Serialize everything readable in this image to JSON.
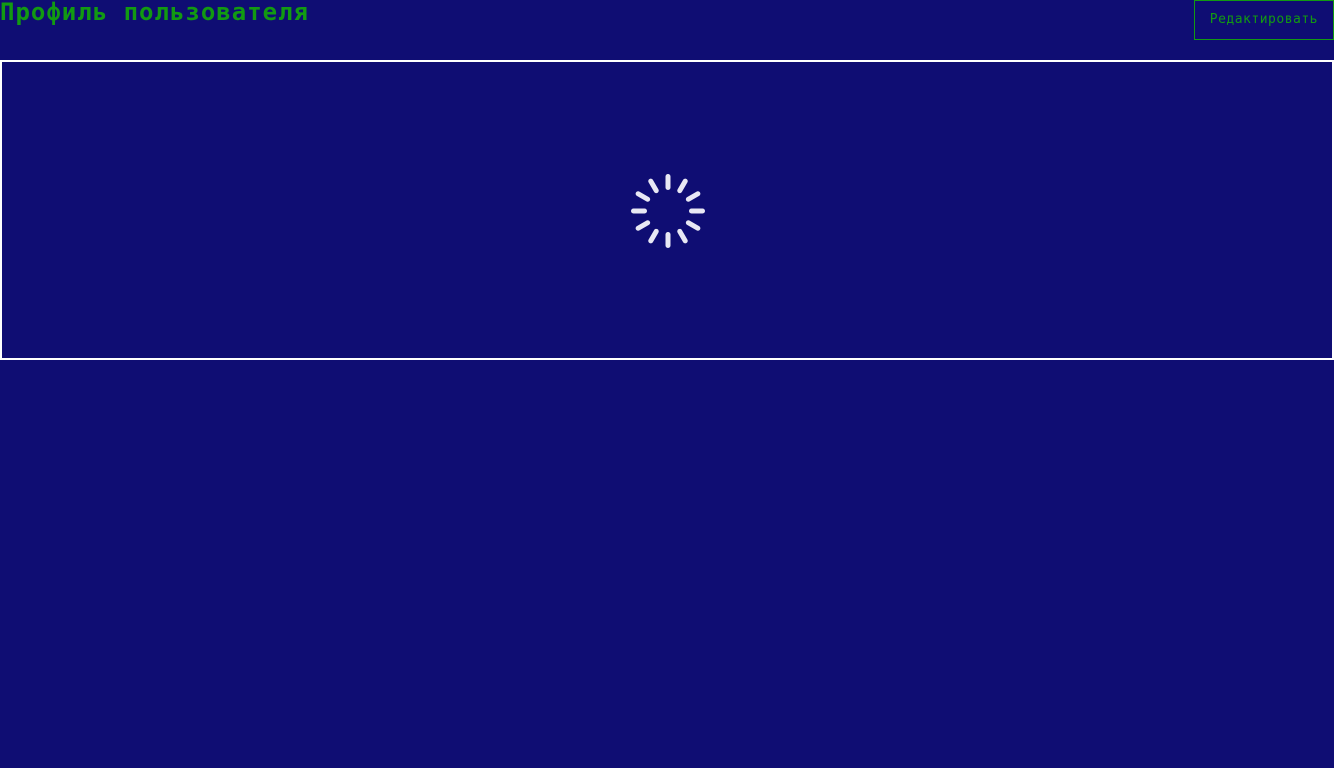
{
  "header": {
    "title": "Профиль пользователя",
    "edit_label": "Редактировать"
  },
  "content": {
    "state": "loading",
    "spinner_icon": "loading-spinner-icon"
  },
  "colors": {
    "background": "#0f0d73",
    "accent": "#129a12",
    "panel_border": "#ffffff",
    "spinner": "#e8e8f4"
  }
}
